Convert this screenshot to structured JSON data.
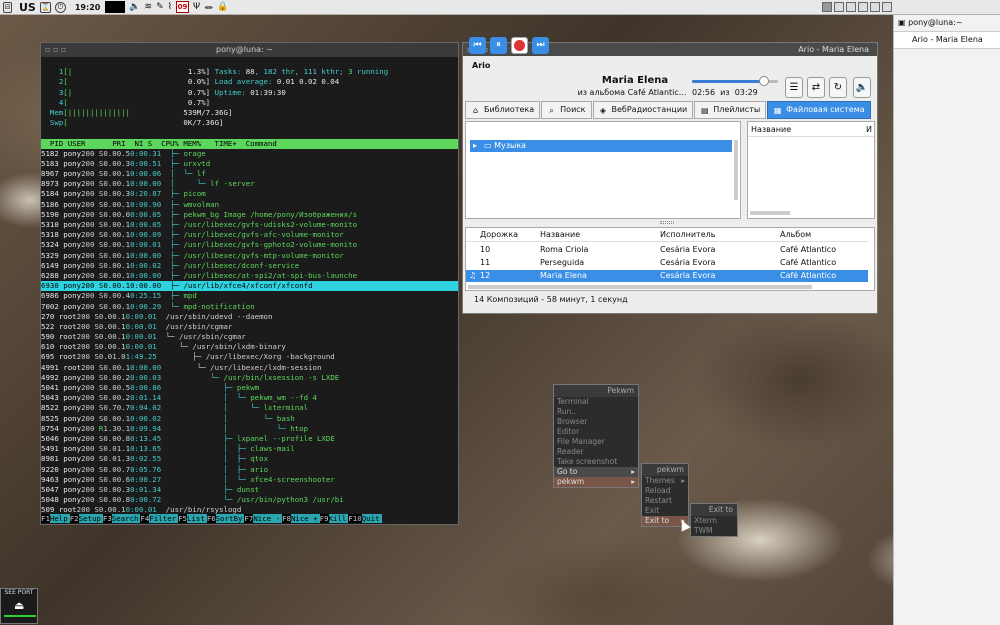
{
  "panel": {
    "layout": "US",
    "clock": "19:20",
    "calendar_day": "09",
    "icons": [
      "lock-icon",
      "power-icon",
      "hourglass-icon",
      "volume-icon",
      "wifi-icon",
      "pen-icon",
      "ruler-icon",
      "trident-icon",
      "usb-icon",
      "padlock-icon"
    ]
  },
  "tasks": [
    {
      "label": "pony@luna:~"
    },
    {
      "label": "Ario - Maria Elena"
    }
  ],
  "terminal": {
    "title": "pony@luna: ~",
    "cpu": [
      {
        "n": "1",
        "bar": "[|",
        "pct": "1.3%]"
      },
      {
        "n": "2",
        "bar": "[",
        "pct": "0.0%]"
      },
      {
        "n": "3",
        "bar": "[|",
        "pct": "0.7%]"
      },
      {
        "n": "4",
        "bar": "[",
        "pct": "0.7%]"
      }
    ],
    "mem": {
      "label": "Mem",
      "bar": "[||||||||||||||",
      "val": "539M/7.36G]"
    },
    "swp": {
      "label": "Swp",
      "bar": "[",
      "val": "0K/7.36G]"
    },
    "tasks_line": [
      "Tasks: ",
      "88",
      ", 182 thr, 111 kthr; ",
      "3",
      " running"
    ],
    "load_line": [
      "Load average: ",
      "0.01 0.02 0.04"
    ],
    "uptime_line": [
      "Uptime: ",
      "01:39:30"
    ],
    "columns": "  PID USER      PRI  NI S  CPU% MEM%   TIME+  Command",
    "rows": [
      {
        "pid": "5182",
        "user": "pony",
        "pri": "20",
        "ni": "0",
        "s": "S",
        "cpu": "0.0",
        "mem": "0.5",
        "time": "0:00.31",
        "tree": "├─ ",
        "cmd": "orage",
        "cls": "g"
      },
      {
        "pid": "5183",
        "user": "pony",
        "pri": "20",
        "ni": "0",
        "s": "S",
        "cpu": "0.0",
        "mem": "0.3",
        "time": "0:00.51",
        "tree": "├─ ",
        "cmd": "urxvtd",
        "cls": "g"
      },
      {
        "pid": "8967",
        "user": "pony",
        "pri": "20",
        "ni": "0",
        "s": "S",
        "cpu": "0.0",
        "mem": "0.1",
        "time": "0:00.06",
        "tree": "│  └─ ",
        "cmd": "lf",
        "cls": "g"
      },
      {
        "pid": "8973",
        "user": "pony",
        "pri": "20",
        "ni": "0",
        "s": "S",
        "cpu": "0.0",
        "mem": "0.1",
        "time": "0:00.00",
        "tree": "│     └─ ",
        "cmd": "lf -server",
        "cls": "g"
      },
      {
        "pid": "5184",
        "user": "pony",
        "pri": "20",
        "ni": "0",
        "s": "S",
        "cpu": "0.0",
        "mem": "0.3",
        "time": "0:20.87",
        "tree": "├─ ",
        "cmd": "picom",
        "cls": "g"
      },
      {
        "pid": "5186",
        "user": "pony",
        "pri": "20",
        "ni": "0",
        "s": "S",
        "cpu": "0.0",
        "mem": "0.1",
        "time": "0:00.90",
        "tree": "├─ ",
        "cmd": "wmvolman",
        "cls": "g"
      },
      {
        "pid": "5190",
        "user": "pony",
        "pri": "20",
        "ni": "0",
        "s": "S",
        "cpu": "0.0",
        "mem": "0.0",
        "time": "0:00.05",
        "tree": "├─ ",
        "cmd": "pekwm_bg Image /home/pony/Изображения/s",
        "cls": "g"
      },
      {
        "pid": "5310",
        "user": "pony",
        "pri": "20",
        "ni": "0",
        "s": "S",
        "cpu": "0.0",
        "mem": "0.1",
        "time": "0:00.05",
        "tree": "├─ ",
        "cmd": "/usr/libexec/gvfs-udisks2-volume-monito",
        "cls": "g"
      },
      {
        "pid": "5318",
        "user": "pony",
        "pri": "20",
        "ni": "0",
        "s": "S",
        "cpu": "0.0",
        "mem": "0.1",
        "time": "0:00.09",
        "tree": "├─ ",
        "cmd": "/usr/libexec/gvfs-afc-volume-monitor",
        "cls": "g"
      },
      {
        "pid": "5324",
        "user": "pony",
        "pri": "20",
        "ni": "0",
        "s": "S",
        "cpu": "0.0",
        "mem": "0.1",
        "time": "0:00.01",
        "tree": "├─ ",
        "cmd": "/usr/libexec/gvfs-gphoto2-volume-monito",
        "cls": "g"
      },
      {
        "pid": "5329",
        "user": "pony",
        "pri": "20",
        "ni": "0",
        "s": "S",
        "cpu": "0.0",
        "mem": "0.1",
        "time": "0:00.00",
        "tree": "├─ ",
        "cmd": "/usr/libexec/gvfs-mtp-volume-monitor",
        "cls": "g"
      },
      {
        "pid": "6149",
        "user": "pony",
        "pri": "20",
        "ni": "0",
        "s": "S",
        "cpu": "0.0",
        "mem": "0.1",
        "time": "0:00.02",
        "tree": "├─ ",
        "cmd": "/usr/libexec/dconf-service",
        "cls": "g"
      },
      {
        "pid": "6288",
        "user": "pony",
        "pri": "20",
        "ni": "0",
        "s": "S",
        "cpu": "0.0",
        "mem": "0.1",
        "time": "0:00.00",
        "tree": "├─ ",
        "cmd": "/usr/libexec/at-spi2/at-spi-bus-launche",
        "cls": "g"
      },
      {
        "pid": "6930",
        "user": "pony",
        "pri": "20",
        "ni": "0",
        "s": "S",
        "cpu": "0.0",
        "mem": "0.1",
        "time": "0:00.00",
        "tree": "├─ ",
        "cmd": "/usr/lib/xfce4/xfconf/xfconfd",
        "cls": "sel"
      },
      {
        "pid": "6986",
        "user": "pony",
        "pri": "20",
        "ni": "0",
        "s": "S",
        "cpu": "0.0",
        "mem": "0.4",
        "time": "0:25.15",
        "tree": "├─ ",
        "cmd": "mpd",
        "cls": "g"
      },
      {
        "pid": "7002",
        "user": "pony",
        "pri": "20",
        "ni": "0",
        "s": "S",
        "cpu": "0.0",
        "mem": "0.1",
        "time": "0:00.29",
        "tree": "└─ ",
        "cmd": "mpd-notification",
        "cls": "g"
      },
      {
        "pid": "270",
        "user": "root",
        "pri": "20",
        "ni": "0",
        "s": "S",
        "cpu": "0.0",
        "mem": "0.1",
        "time": "0:00.01",
        "tree": "/usr/sbin/udevd --daemon",
        "cmd": "",
        "cls": "d"
      },
      {
        "pid": "522",
        "user": "root",
        "pri": "20",
        "ni": "0",
        "s": "S",
        "cpu": "0.0",
        "mem": "0.1",
        "time": "0:00.01",
        "tree": "/usr/sbin/cgmar",
        "cmd": "",
        "cls": "d"
      },
      {
        "pid": "590",
        "user": "root",
        "pri": "20",
        "ni": "0",
        "s": "S",
        "cpu": "0.0",
        "mem": "0.1",
        "time": "0:00.01",
        "tree": "└─ /usr/sbin/cgmar",
        "cmd": "",
        "cls": "d"
      },
      {
        "pid": "610",
        "user": "root",
        "pri": "20",
        "ni": "0",
        "s": "S",
        "cpu": "0.0",
        "mem": "0.1",
        "time": "0:00.01",
        "tree": "   └─ /usr/sbin/lxdm-binary",
        "cmd": "",
        "cls": "d"
      },
      {
        "pid": "695",
        "user": "root",
        "pri": "20",
        "ni": "0",
        "s": "S",
        "cpu": "0.0",
        "mem": "1.0",
        "time": "1:49.25",
        "tree": "      ├─ /usr/libexec/Xorg -background",
        "cmd": "",
        "cls": "d"
      },
      {
        "pid": "4991",
        "user": "root",
        "pri": "20",
        "ni": "0",
        "s": "S",
        "cpu": "0.0",
        "mem": "0.1",
        "time": "0:00.00",
        "tree": "      └─ /usr/libexec/lxdm-session",
        "cmd": "",
        "cls": "d"
      },
      {
        "pid": "4992",
        "user": "pony",
        "pri": "20",
        "ni": "0",
        "s": "S",
        "cpu": "0.0",
        "mem": "0.2",
        "time": "0:00.03",
        "tree": "         └─ ",
        "cmd": "/usr/bin/lxsession -s LXDE",
        "cls": "g"
      },
      {
        "pid": "5041",
        "user": "pony",
        "pri": "20",
        "ni": "0",
        "s": "S",
        "cpu": "0.0",
        "mem": "0.5",
        "time": "0:00.86",
        "tree": "            ├─ ",
        "cmd": "pekwm",
        "cls": "g"
      },
      {
        "pid": "5043",
        "user": "pony",
        "pri": "20",
        "ni": "0",
        "s": "S",
        "cpu": "0.0",
        "mem": "0.2",
        "time": "0:01.14",
        "tree": "            │  └─ ",
        "cmd": "pekwm_wm --fd 4",
        "cls": "g"
      },
      {
        "pid": "8522",
        "user": "pony",
        "pri": "20",
        "ni": "0",
        "s": "S",
        "cpu": "0.7",
        "mem": "0.7",
        "time": "0:04.02",
        "tree": "            │     └─ ",
        "cmd": "lxterminal",
        "cls": "g"
      },
      {
        "pid": "8525",
        "user": "pony",
        "pri": "20",
        "ni": "0",
        "s": "S",
        "cpu": "0.0",
        "mem": "0.1",
        "time": "0:00.02",
        "tree": "            │        └─ ",
        "cmd": "bash",
        "cls": "g"
      },
      {
        "pid": "8754",
        "user": "pony",
        "pri": "20",
        "ni": "0",
        "s": "R",
        "cpu": "1.3",
        "mem": "0.1",
        "time": "0:09.94",
        "tree": "            │           └─ ",
        "cmd": "htop",
        "cls": "g"
      },
      {
        "pid": "5046",
        "user": "pony",
        "pri": "20",
        "ni": "0",
        "s": "S",
        "cpu": "0.0",
        "mem": "0.8",
        "time": "0:13.45",
        "tree": "            ├─ ",
        "cmd": "lxpanel --profile LXDE",
        "cls": "g"
      },
      {
        "pid": "5491",
        "user": "pony",
        "pri": "20",
        "ni": "0",
        "s": "S",
        "cpu": "0.0",
        "mem": "1.1",
        "time": "0:13.65",
        "tree": "            │  ├─ ",
        "cmd": "claws-mail",
        "cls": "g"
      },
      {
        "pid": "8981",
        "user": "pony",
        "pri": "20",
        "ni": "0",
        "s": "S",
        "cpu": "0.0",
        "mem": "1.3",
        "time": "0:02.55",
        "tree": "            │  ├─ ",
        "cmd": "qtox",
        "cls": "g"
      },
      {
        "pid": "9220",
        "user": "pony",
        "pri": "20",
        "ni": "0",
        "s": "S",
        "cpu": "0.0",
        "mem": "0.7",
        "time": "0:05.76",
        "tree": "            │  ├─ ",
        "cmd": "ario",
        "cls": "g"
      },
      {
        "pid": "9463",
        "user": "pony",
        "pri": "20",
        "ni": "0",
        "s": "S",
        "cpu": "0.0",
        "mem": "0.6",
        "time": "0:00.27",
        "tree": "            │  └─ ",
        "cmd": "xfce4-screenshooter",
        "cls": "g"
      },
      {
        "pid": "5047",
        "user": "pony",
        "pri": "20",
        "ni": "0",
        "s": "S",
        "cpu": "0.0",
        "mem": "0.3",
        "time": "0:01.34",
        "tree": "            ├─ ",
        "cmd": "dunst",
        "cls": "g"
      },
      {
        "pid": "5048",
        "user": "pony",
        "pri": "20",
        "ni": "0",
        "s": "S",
        "cpu": "0.0",
        "mem": "0.8",
        "time": "0:00.72",
        "tree": "            └─ ",
        "cmd": "/usr/bin/python3 /usr/bi",
        "cls": "g"
      },
      {
        "pid": "509",
        "user": "root",
        "pri": "20",
        "ni": "0",
        "s": "S",
        "cpu": "0.0",
        "mem": "0.1",
        "time": "0:00.01",
        "tree": "/usr/bin/rsyslogd",
        "cmd": "",
        "cls": "d"
      }
    ],
    "fkeys": [
      {
        "k": "F1",
        "l": "Help"
      },
      {
        "k": "F2",
        "l": "Setup"
      },
      {
        "k": "F3",
        "l": "Search"
      },
      {
        "k": "F4",
        "l": "Filter"
      },
      {
        "k": "F5",
        "l": "List"
      },
      {
        "k": "F6",
        "l": "SortBy"
      },
      {
        "k": "F7",
        "l": "Nice -"
      },
      {
        "k": "F8",
        "l": "Nice +"
      },
      {
        "k": "F9",
        "l": "Kill"
      },
      {
        "k": "F10",
        "l": "Quit"
      }
    ]
  },
  "ario": {
    "window_title": "Ario - Maria Elena",
    "app": "Ario",
    "song_title": "Maria Elena",
    "song_album": "из альбома  Café Atlantic...",
    "elapsed": "02:56",
    "of": "из",
    "total": "03:29",
    "progress": 0.843,
    "tabs": [
      {
        "label": "Библиотека",
        "icon": "home-icon"
      },
      {
        "label": "Поиск",
        "icon": "search-icon"
      },
      {
        "label": "ВебРадиостанции",
        "icon": "radio-icon"
      },
      {
        "label": "Плейлисты",
        "icon": "playlist-icon"
      },
      {
        "label": "Файловая система",
        "icon": "filesystem-icon",
        "active": true
      }
    ],
    "tree_item": "Музыка",
    "file_col_name": "Название",
    "file_col_i": "И",
    "song_cols": {
      "track": "Дорожка",
      "title": "Название",
      "artist": "Исполнитель",
      "album": "Альбом"
    },
    "songs": [
      {
        "track": "10",
        "title": "Roma Criola",
        "artist": "Cesária Evora",
        "album": "Café Atlantico"
      },
      {
        "track": "11",
        "title": "Perseguida",
        "artist": "Cesária Evora",
        "album": "Café Atlantico"
      },
      {
        "track": "12",
        "title": "Maria Elena",
        "artist": "Cesária Evora",
        "album": "Café Atlantico",
        "playing": true
      }
    ],
    "status": "14 Композиций - 58 минут, 1 секунд"
  },
  "menu": {
    "title": "Pekwm",
    "items": [
      "Terminal",
      "Run..",
      "Browser",
      "Editor",
      "File Manager",
      "Reader",
      "Take screenshot",
      "Go to",
      "pekwm"
    ],
    "sub_title": "pekwm",
    "sub_items": [
      "Themes",
      "Reload",
      "Restart",
      "Exit",
      "Exit to"
    ],
    "exit_title": "Exit to",
    "exit_items": [
      "Xterm",
      "TWM"
    ]
  },
  "sysmon": {
    "label": "SEE PORT"
  },
  "colors": {
    "accent": "#3a8ee6",
    "htop_green": "#5cd65c",
    "htop_selected": "#2fd3e0"
  }
}
